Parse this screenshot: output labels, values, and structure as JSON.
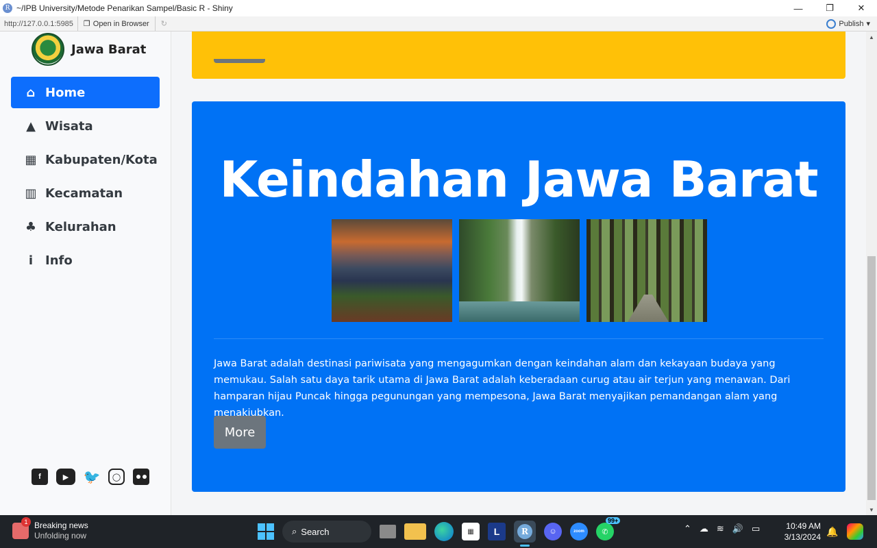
{
  "window": {
    "title": "~/IPB University/Metode Penarikan Sampel/Basic R - Shiny",
    "r_logo": "R",
    "minimize": "—",
    "maximize": "❐",
    "close": "✕"
  },
  "viewer_toolbar": {
    "url": "http://127.0.0.1:5985",
    "open_in_browser": "Open in Browser",
    "publish": "Publish"
  },
  "sidebar": {
    "brand": "Jawa Barat",
    "items": [
      {
        "label": "Home",
        "icon": "home-icon",
        "active": true
      },
      {
        "label": "Wisata",
        "icon": "mountain-icon",
        "active": false
      },
      {
        "label": "Kabupaten/Kota",
        "icon": "building-icon",
        "active": false
      },
      {
        "label": "Kecamatan",
        "icon": "city-icon",
        "active": false
      },
      {
        "label": "Kelurahan",
        "icon": "tree-city-icon",
        "active": false
      },
      {
        "label": "Info",
        "icon": "info-icon",
        "active": false
      }
    ],
    "social": [
      "facebook-icon",
      "youtube-icon",
      "twitter-icon",
      "instagram-icon",
      "flickr-icon"
    ]
  },
  "main": {
    "hero_title": "Keindahan Jawa Barat",
    "description": "Jawa Barat adalah destinasi pariwisata yang mengagumkan dengan keindahan alam dan kekayaan budaya yang memukau. Salah satu daya tarik utama di Jawa Barat adalah keberadaan curug atau air terjun yang menawan. Dari hamparan hijau Puncak hingga pegunungan yang mempesona, Jawa Barat menyajikan pemandangan alam yang menakjubkan.",
    "more_button": "More",
    "colors": {
      "accent": "#0d6efd",
      "card_blue": "#0072f5",
      "card_yellow": "#ffc107",
      "button_gray": "#6c757d"
    }
  },
  "taskbar": {
    "news_title": "Breaking news",
    "news_subtitle": "Unfolding now",
    "news_badge": "1",
    "search": "Search",
    "letter_app": "L",
    "rstudio": "R",
    "zoom": "zoom",
    "whatsapp_badge": "99+",
    "time": "10:49 AM",
    "date": "3/13/2024"
  }
}
